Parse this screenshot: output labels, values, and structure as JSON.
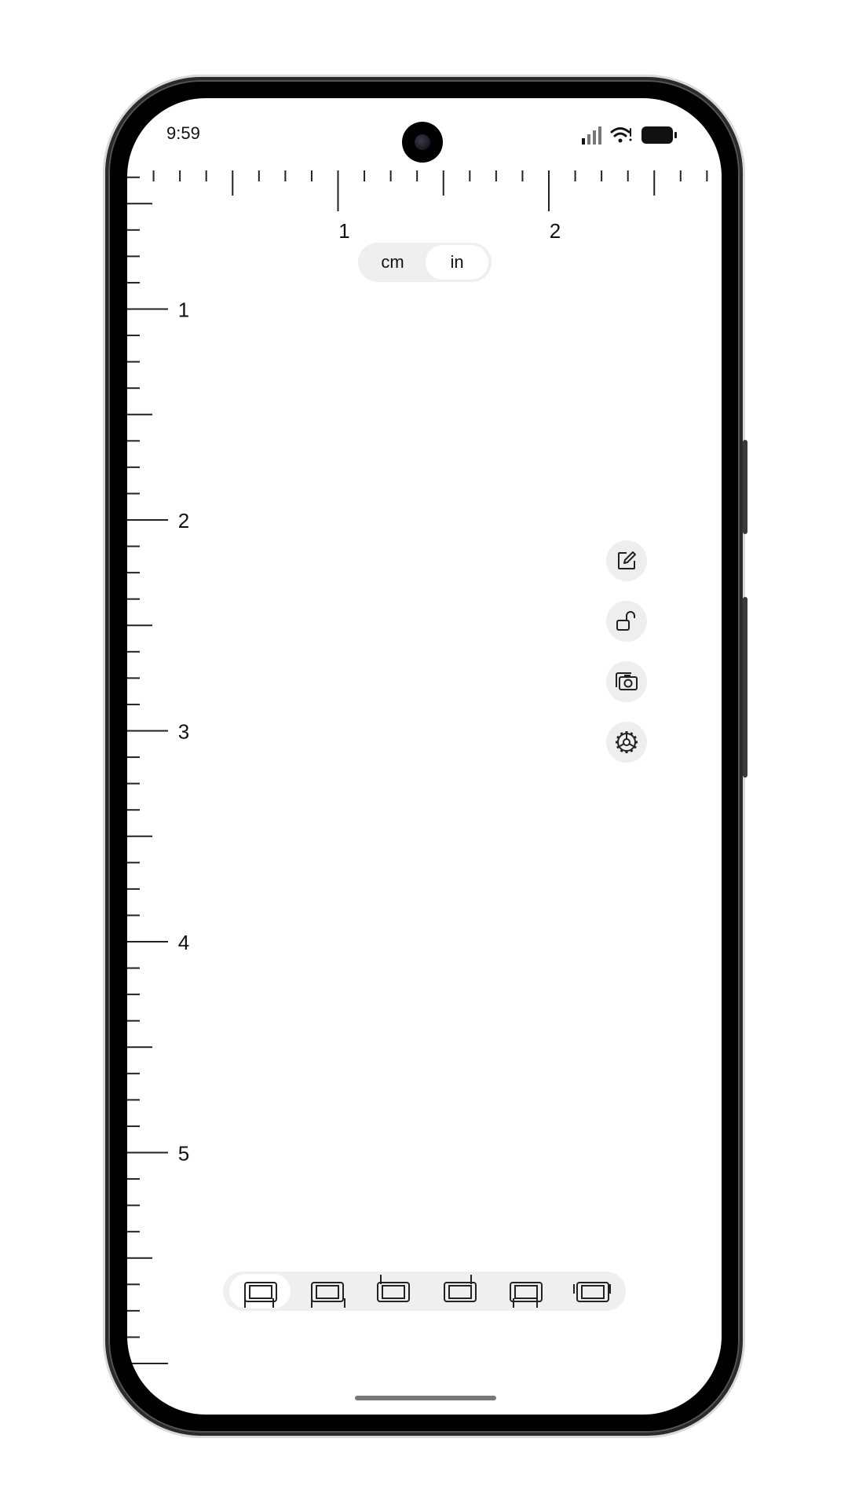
{
  "status_bar": {
    "time": "9:59",
    "icons": [
      "signal-icon",
      "wifi-icon",
      "battery-icon"
    ]
  },
  "ruler": {
    "unit": "in",
    "top_labels": [
      "1",
      "2"
    ],
    "left_labels": [
      "1",
      "2",
      "3",
      "4",
      "5"
    ],
    "subdivisions_per_inch": 8
  },
  "unit_toggle": {
    "options": [
      "cm",
      "in"
    ],
    "selected": "in"
  },
  "tools": [
    "edit-icon",
    "unlock-icon",
    "screenshot-icon",
    "settings-icon"
  ],
  "mode_bar": {
    "modes": [
      "mode-bottom-left",
      "mode-bottom-right",
      "mode-top-left",
      "mode-top-right",
      "mode-bottom-both",
      "mode-sides"
    ],
    "selected_index": 0
  },
  "colors": {
    "tick": "#222222",
    "button_bg": "#eeeeee",
    "frame": "#000000"
  }
}
